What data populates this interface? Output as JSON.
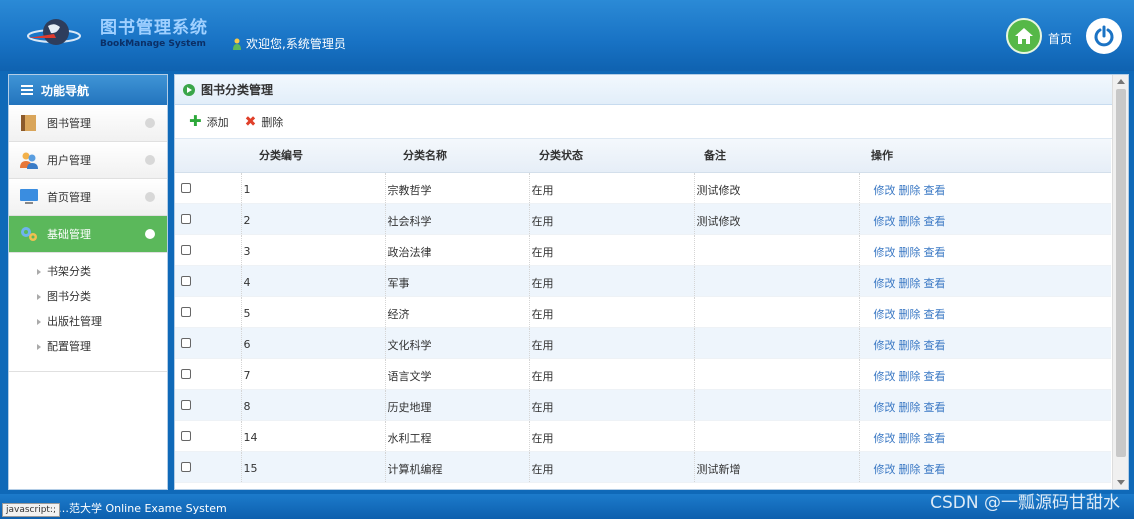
{
  "header": {
    "title_cn": "图书管理系统",
    "title_en": "BookManage System",
    "welcome": "欢迎您,系统管理员",
    "home_label": "首页"
  },
  "sidebar": {
    "heading": "功能导航",
    "items": [
      {
        "label": "图书管理",
        "icon": "book-icon"
      },
      {
        "label": "用户管理",
        "icon": "users-icon"
      },
      {
        "label": "首页管理",
        "icon": "monitor-icon"
      },
      {
        "label": "基础管理",
        "icon": "gears-icon",
        "active": true
      }
    ],
    "submenu": [
      "书架分类",
      "图书分类",
      "出版社管理",
      "配置管理"
    ]
  },
  "main": {
    "title": "图书分类管理",
    "toolbar": {
      "add": "添加",
      "delete": "删除"
    },
    "columns": [
      "分类编号",
      "分类名称",
      "分类状态",
      "备注",
      "操作"
    ],
    "rows": [
      {
        "id": "1",
        "name": "宗教哲学",
        "status": "在用",
        "note": "测试修改"
      },
      {
        "id": "2",
        "name": "社会科学",
        "status": "在用",
        "note": "测试修改"
      },
      {
        "id": "3",
        "name": "政治法律",
        "status": "在用",
        "note": ""
      },
      {
        "id": "4",
        "name": "军事",
        "status": "在用",
        "note": ""
      },
      {
        "id": "5",
        "name": "经济",
        "status": "在用",
        "note": ""
      },
      {
        "id": "6",
        "name": "文化科学",
        "status": "在用",
        "note": ""
      },
      {
        "id": "7",
        "name": "语言文学",
        "status": "在用",
        "note": ""
      },
      {
        "id": "8",
        "name": "历史地理",
        "status": "在用",
        "note": ""
      },
      {
        "id": "14",
        "name": "水利工程",
        "status": "在用",
        "note": ""
      },
      {
        "id": "15",
        "name": "计算机编程",
        "status": "在用",
        "note": "测试新增"
      }
    ],
    "ops": [
      "修改",
      "删除",
      "查看"
    ]
  },
  "footer": {
    "text": "…范大学 Online Exame System",
    "status_tip": "javascript:;",
    "watermark": "CSDN @一瓢源码甘甜水"
  },
  "colors": {
    "header_blue": "#1872c4",
    "active_green": "#5bb85b",
    "link_blue": "#3a78c4"
  }
}
